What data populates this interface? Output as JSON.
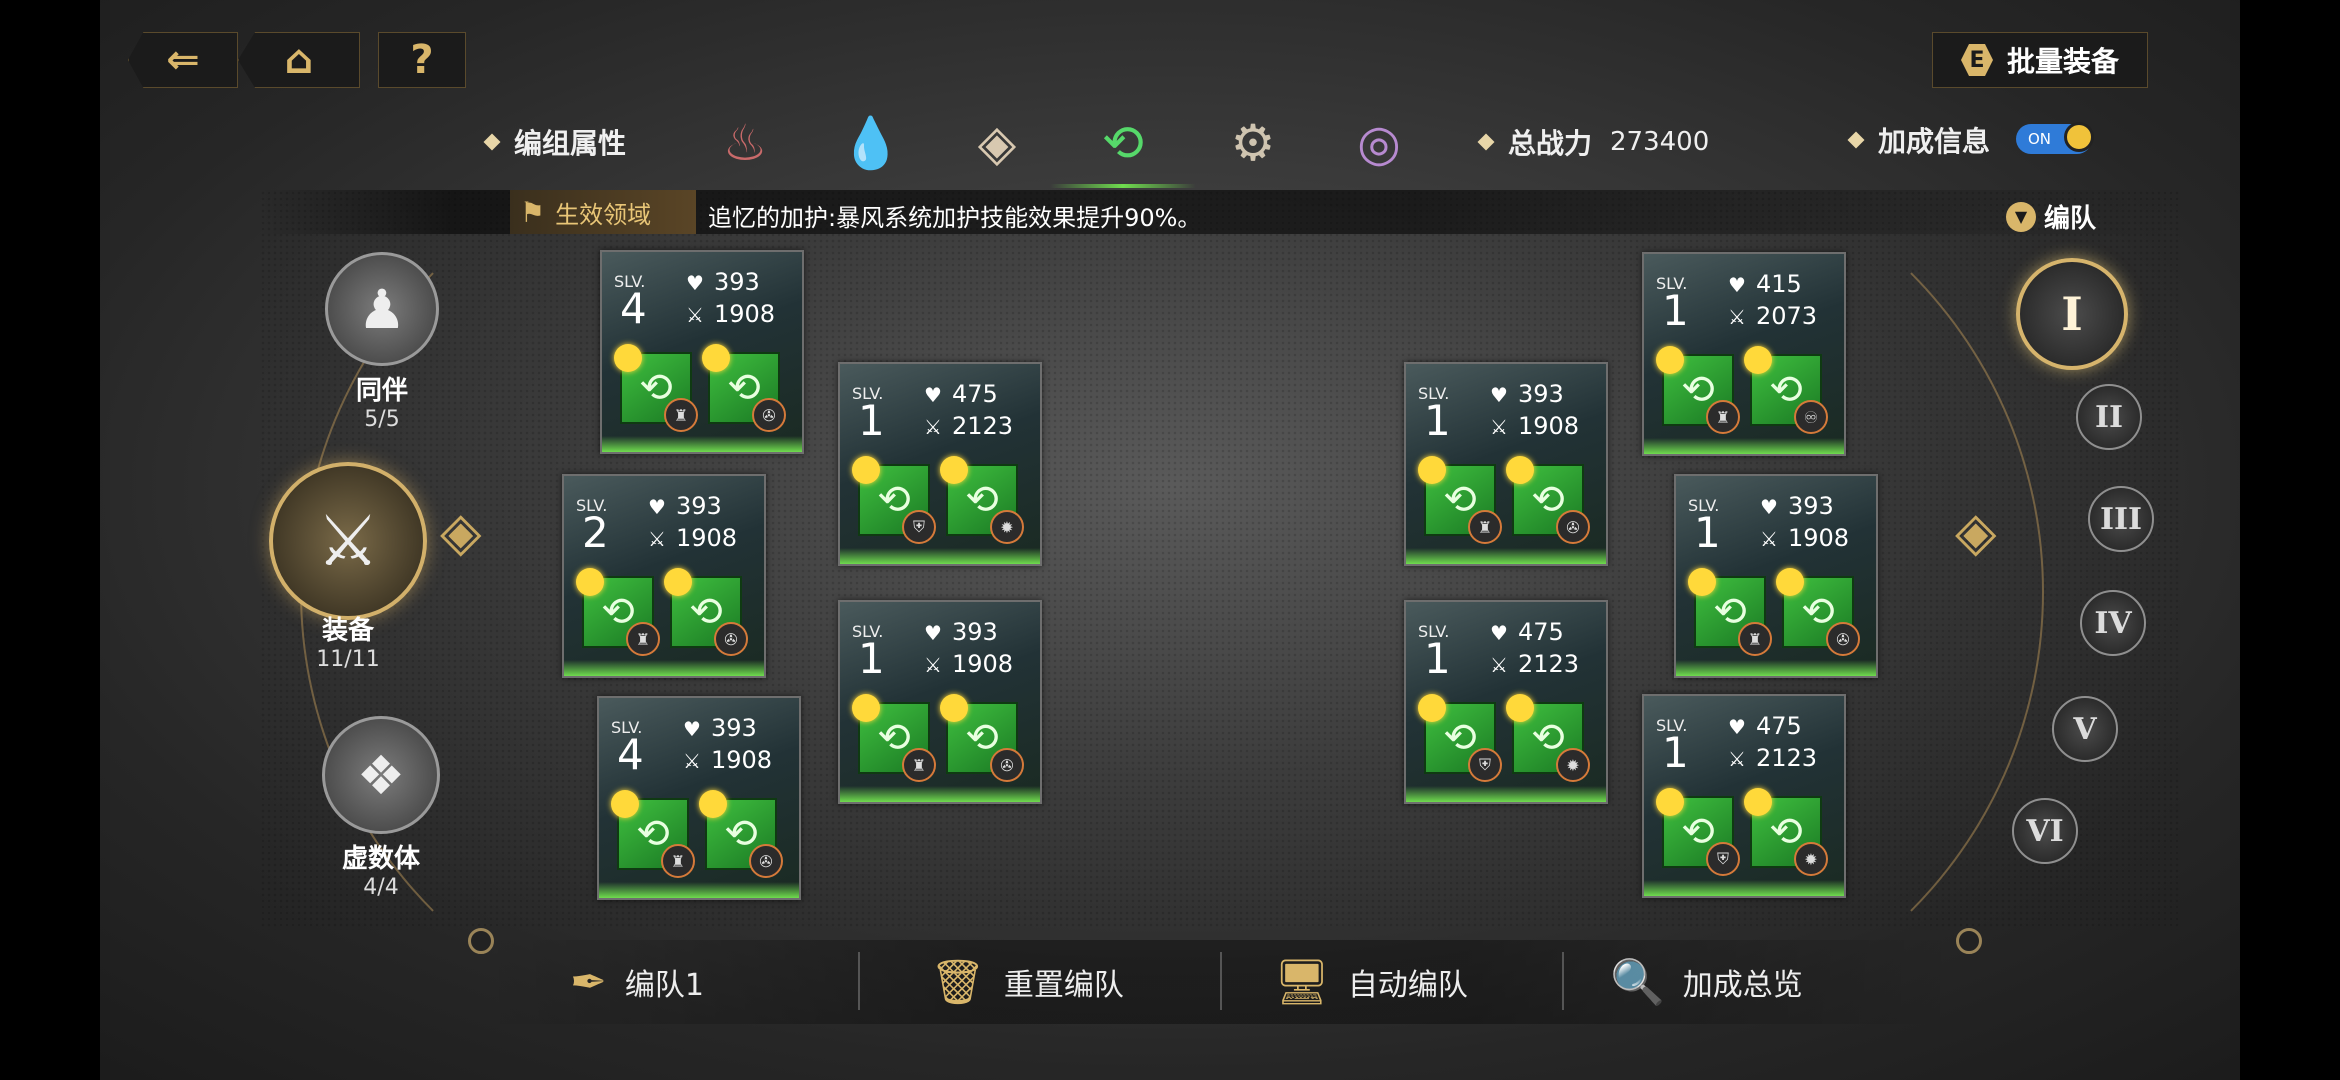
{
  "top": {
    "back_icon": "back-arrow-icon",
    "home_icon": "home-icon",
    "help_label": "?",
    "batch_key": "E",
    "batch_label": "批量装备"
  },
  "header": {
    "group_attr_label": "编组属性",
    "elements": [
      "fire-icon",
      "water-icon",
      "earth-icon",
      "wind-icon",
      "gear-icon",
      "spiral-icon"
    ],
    "selected_element": 3,
    "power_label": "总战力",
    "power_value": "273400",
    "bonus_label": "加成信息",
    "bonus_toggle": "ON"
  },
  "banner": {
    "tag": "生效领域",
    "text": "追忆的加护:暴风系统加护技能效果提升90%。"
  },
  "formation_label": "编队",
  "sidebar": {
    "companion": {
      "label": "同伴",
      "count": "5/5"
    },
    "equipment": {
      "label": "装备",
      "count": "11/11"
    },
    "imaginary": {
      "label": "虚数体",
      "count": "4/4"
    }
  },
  "teams": [
    "I",
    "II",
    "III",
    "IV",
    "V",
    "VI"
  ],
  "cards": [
    {
      "slv": "SLV.",
      "level": "4",
      "hp": "393",
      "atk": "1908",
      "sub1": "♜",
      "sub2": "✇"
    },
    {
      "slv": "SLV.",
      "level": "2",
      "hp": "393",
      "atk": "1908",
      "sub1": "♜",
      "sub2": "✇"
    },
    {
      "slv": "SLV.",
      "level": "4",
      "hp": "393",
      "atk": "1908",
      "sub1": "♜",
      "sub2": "✇"
    },
    {
      "slv": "SLV.",
      "level": "1",
      "hp": "475",
      "atk": "2123",
      "sub1": "⛨",
      "sub2": "✹"
    },
    {
      "slv": "SLV.",
      "level": "1",
      "hp": "393",
      "atk": "1908",
      "sub1": "♜",
      "sub2": "✇"
    },
    {
      "slv": "SLV.",
      "level": "1",
      "hp": "393",
      "atk": "1908",
      "sub1": "♜",
      "sub2": "✇"
    },
    {
      "slv": "SLV.",
      "level": "1",
      "hp": "475",
      "atk": "2123",
      "sub1": "⛨",
      "sub2": "✹"
    },
    {
      "slv": "SLV.",
      "level": "1",
      "hp": "415",
      "atk": "2073",
      "sub1": "♜",
      "sub2": "♾"
    },
    {
      "slv": "SLV.",
      "level": "1",
      "hp": "393",
      "atk": "1908",
      "sub1": "♜",
      "sub2": "✇"
    },
    {
      "slv": "SLV.",
      "level": "1",
      "hp": "475",
      "atk": "2123",
      "sub1": "⛨",
      "sub2": "✹"
    }
  ],
  "bottom": {
    "team_name": "编队1",
    "reset": "重置编队",
    "auto": "自动编队",
    "overview": "加成总览"
  },
  "colors": {
    "gold": "#d9b66a",
    "green": "#3fbf3f",
    "toggle": "#2f7bd8"
  }
}
